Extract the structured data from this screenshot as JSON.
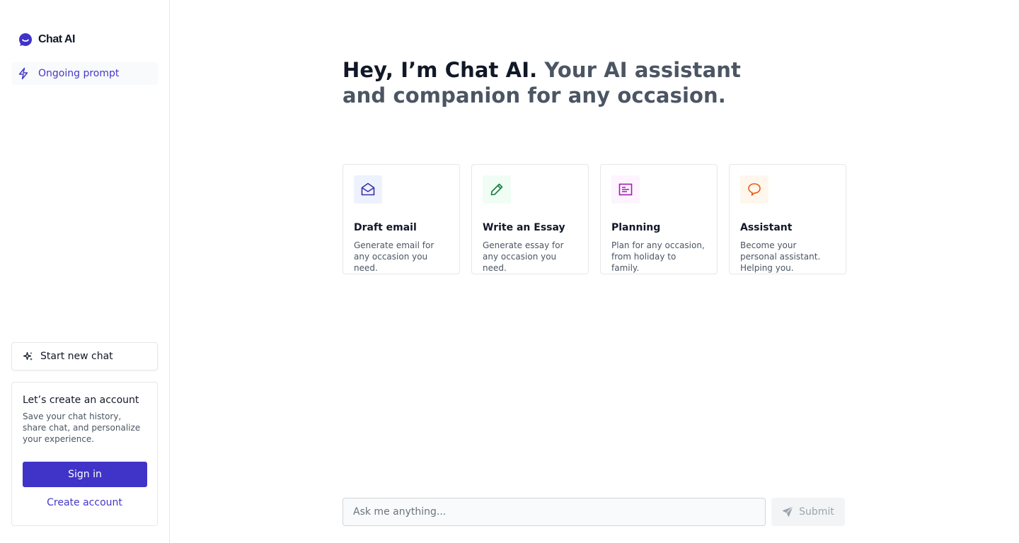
{
  "app": {
    "name": "Chat AI",
    "accent": "#4033c8"
  },
  "sidebar": {
    "items": [
      {
        "label": "Ongoing prompt",
        "icon": "lightning-icon"
      }
    ],
    "new_chat": {
      "label": "Start new chat",
      "icon": "sparkles-icon"
    },
    "account": {
      "title": "Let’s create an account",
      "description": "Save your chat history, share chat, and personalize your experience.",
      "sign_in_label": "Sign in",
      "create_account_label": "Create account"
    }
  },
  "main": {
    "headline_strong": "Hey, I’m Chat AI.",
    "headline_rest": " Your AI assistant and companion for any occasion.",
    "cards": [
      {
        "title": "Draft email",
        "description": "Generate email for any occasion you need.",
        "icon": "mail-open-icon",
        "icon_color": "#3730a3",
        "icon_bg": "#eef2ff"
      },
      {
        "title": "Write an Essay",
        "description": "Generate essay for any occasion you need.",
        "icon": "pencil-icon",
        "icon_color": "#15803d",
        "icon_bg": "#f0fdf4"
      },
      {
        "title": "Planning",
        "description": "Plan for any occasion, from holiday to family.",
        "icon": "document-text-icon",
        "icon_color": "#a21caf",
        "icon_bg": "#fdf4ff"
      },
      {
        "title": "Assistant",
        "description": "Become your personal assistant. Helping you.",
        "icon": "chat-bubble-icon",
        "icon_color": "#ea580c",
        "icon_bg": "#fff7ed"
      }
    ],
    "composer": {
      "placeholder": "Ask me anything...",
      "value": "",
      "submit_label": "Submit",
      "submit_icon": "send-icon"
    }
  }
}
